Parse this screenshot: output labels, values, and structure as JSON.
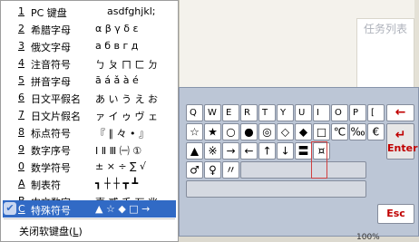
{
  "menu": {
    "items": [
      {
        "num": "1",
        "label": "PC 键盘",
        "preview": "asdfghjkl;"
      },
      {
        "num": "2",
        "label": "希腊字母",
        "preview": "α β γ δ ε"
      },
      {
        "num": "3",
        "label": "俄文字母",
        "preview": "а б в г д"
      },
      {
        "num": "4",
        "label": "注音符号",
        "preview": "ㄅ ㄆ ㄇ ㄈ ㄉ"
      },
      {
        "num": "5",
        "label": "拼音字母",
        "preview": "ā á ǎ à é"
      },
      {
        "num": "6",
        "label": "日文平假名",
        "preview": "あ い う え お"
      },
      {
        "num": "7",
        "label": "日文片假名",
        "preview": "ァ イ ゥ ヴ ェ"
      },
      {
        "num": "8",
        "label": "标点符号",
        "preview": "『 ∥ 々 • 』"
      },
      {
        "num": "9",
        "label": "数字序号",
        "preview": "Ⅰ Ⅱ Ⅲ ㈠ ①"
      },
      {
        "num": "0",
        "label": "数学符号",
        "preview": "± × ÷ ∑ √"
      },
      {
        "num": "A",
        "label": "制表符",
        "preview": "┓ ┼ ┼ ┳ ┻"
      },
      {
        "num": "B",
        "label": "中文数字",
        "preview": "壹 貳 千 万 兆"
      },
      {
        "num": "C",
        "label": "特殊符号",
        "preview": "▲ ☆ ◆ □ →"
      }
    ],
    "close_label": "关闭软键盘",
    "close_key": "L"
  },
  "background_window": {
    "text": "任务列表"
  },
  "keyboard": {
    "row1": [
      "Q",
      "W",
      "E",
      "R",
      "T",
      "Y",
      "U",
      "I",
      "O",
      "P",
      "[",
      "]"
    ],
    "row2": [
      "☆",
      "★",
      "○",
      "●",
      "◎",
      "◇",
      "◆",
      "□",
      "℃",
      "‰",
      "€"
    ],
    "row3": [
      "▲",
      "※",
      "→",
      "←",
      "↑",
      "↓",
      "〓",
      "¤",
      "Enter"
    ],
    "row4": [
      "♂",
      "♀",
      "〃"
    ],
    "backspace": "←",
    "enter": "Enter",
    "esc": "Esc",
    "zoom": "100%"
  },
  "colors": {
    "selected": "#316ac5",
    "keyred": "#c00000",
    "keyboard_bg": "#bcc6d6"
  }
}
